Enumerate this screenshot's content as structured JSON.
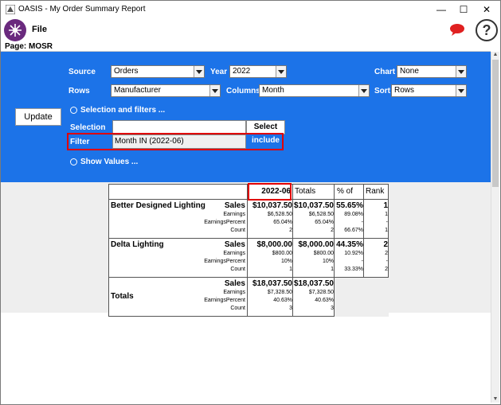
{
  "window": {
    "title": "OASIS - My Order Summary Report",
    "minimize": "—",
    "maximize": "☐",
    "close": "✕"
  },
  "menu": {
    "file": "File"
  },
  "page": {
    "label": "Page:  MOSR"
  },
  "icons": {
    "logo": "oasis-logo-icon",
    "chat": "chat-bubble-icon",
    "help": "help-icon"
  },
  "colors": {
    "panel": "#1c73e8",
    "highlight": "#e00000",
    "report_bg": "#eeeeee",
    "chat": "#e02020"
  },
  "controls": {
    "source": {
      "label": "Source",
      "value": "Orders"
    },
    "year": {
      "label": "Year",
      "value": "2022"
    },
    "chart": {
      "label": "Chart",
      "value": "None"
    },
    "rows": {
      "label": "Rows",
      "value": "Manufacturer"
    },
    "columns": {
      "label": "Columns",
      "value": "Month"
    },
    "sort": {
      "label": "Sort",
      "value": "Rows"
    },
    "update": "Update",
    "selection_filters": "Selection and filters ...",
    "selection": {
      "label": "Selection",
      "value": "",
      "button": "Select"
    },
    "filter": {
      "label": "Filter",
      "value": "Month IN (2022-06)",
      "mode": "include"
    },
    "show_values": "Show Values ..."
  },
  "report": {
    "headers": [
      "",
      "2022-06",
      "Totals",
      "% of",
      "Rank"
    ],
    "metrics": [
      "Sales",
      "Earnings",
      "EarningsPercent",
      "Count"
    ],
    "rows": [
      {
        "name": "Better Designed Lighting",
        "month": [
          "$10,037.50",
          "$6,528.50",
          "65.04%",
          "2"
        ],
        "totals": [
          "$10,037.50",
          "$6,528.50",
          "65.04%",
          "2"
        ],
        "pct": [
          "55.65%",
          "89.08%",
          "-",
          "66.67%"
        ],
        "rank": [
          "1",
          "1",
          "-",
          "1"
        ]
      },
      {
        "name": "Delta Lighting",
        "month": [
          "$8,000.00",
          "$800.00",
          "10%",
          "1"
        ],
        "totals": [
          "$8,000.00",
          "$800.00",
          "10%",
          "1"
        ],
        "pct": [
          "44.35%",
          "10.92%",
          "-",
          "33.33%"
        ],
        "rank": [
          "2",
          "2",
          "-",
          "2"
        ]
      },
      {
        "name": "Totals",
        "month": [
          "$18,037.50",
          "$7,328.50",
          "40.63%",
          "3"
        ],
        "totals": [
          "$18,037.50",
          "$7,328.50",
          "40.63%",
          "3"
        ],
        "pct": [
          "",
          "",
          "",
          ""
        ],
        "rank": [
          "",
          "",
          "",
          ""
        ]
      }
    ]
  }
}
